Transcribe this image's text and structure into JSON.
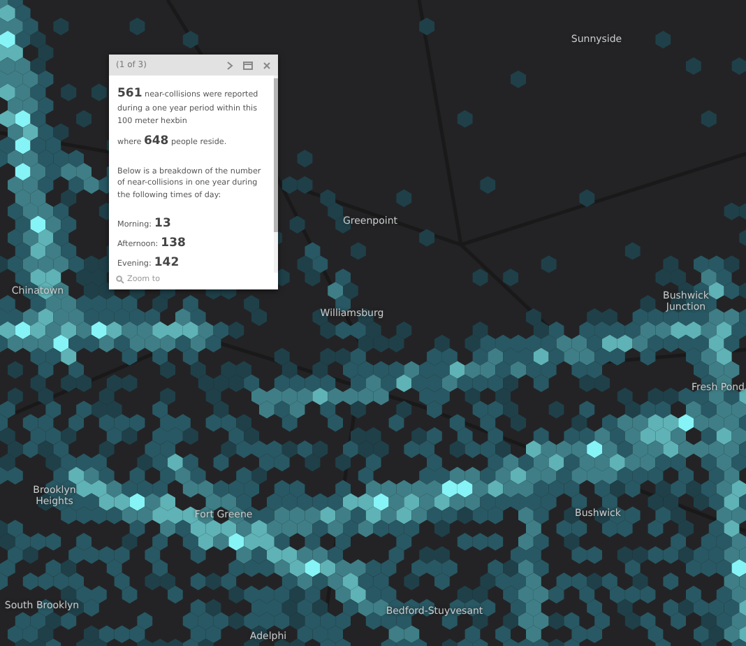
{
  "popup": {
    "counter": "(1 of 3)",
    "paragraphs": [
      "**561** near-collisions were reported during a one year period within this 100 meter hexbin",
      "where **648** people reside.",
      "Below is a breakdown of the number of near-collisions in one year during the following times of day:"
    ],
    "times": [
      {
        "label": "Morning:",
        "value": "13"
      },
      {
        "label": "Afternoon:",
        "value": "138"
      },
      {
        "label": "Evening:",
        "value": "142"
      }
    ],
    "zoom_link": "Zoom to"
  },
  "map_labels": [
    {
      "text": "Sunnyside"
    },
    {
      "text": "Greenpoint"
    },
    {
      "text": "Chinatown"
    },
    {
      "text": "Williamsburg"
    },
    {
      "text": "Bushwick Junction"
    },
    {
      "text": "Fresh Pond"
    },
    {
      "text": "Brooklyn Heights"
    },
    {
      "text": "Fort Greene"
    },
    {
      "text": "Bushwick"
    },
    {
      "text": "South Brooklyn"
    },
    {
      "text": "Bedford-Stuyvesant"
    },
    {
      "text": "Adelphi"
    }
  ]
}
